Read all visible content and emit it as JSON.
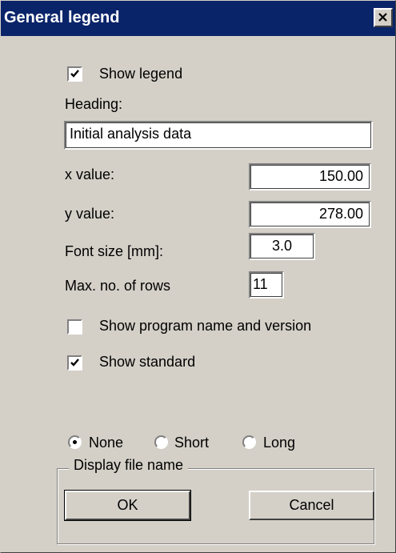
{
  "window": {
    "title": "General legend",
    "close_icon": "close-x-icon"
  },
  "legend": {
    "show_legend_label": "Show legend",
    "show_legend_checked": true,
    "heading_label": "Heading:",
    "heading_value": "Initial analysis data"
  },
  "position": {
    "x_label": "x value:",
    "x_value": "150.00",
    "y_label": "y value:",
    "y_value": "278.00"
  },
  "format": {
    "font_size_label": "Font size [mm]:",
    "font_size_value": "3.0",
    "max_rows_label": "Max. no. of rows",
    "max_rows_value": "11"
  },
  "options": {
    "show_program_label": "Show program name and version",
    "show_program_checked": false,
    "show_standard_label": "Show standard",
    "show_standard_checked": true
  },
  "file_name_group": {
    "title": "Display file name",
    "options": [
      "None",
      "Short",
      "Long"
    ],
    "selected": "None"
  },
  "buttons": {
    "ok": "OK",
    "cancel": "Cancel"
  },
  "colors": {
    "title_bar": "#0a246a",
    "face": "#d4d0c8"
  }
}
